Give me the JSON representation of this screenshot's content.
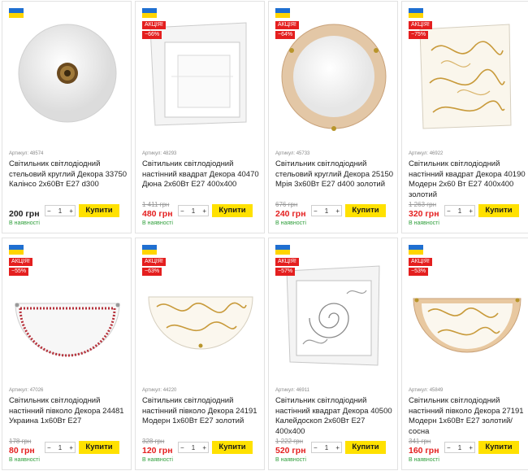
{
  "colors": {
    "sale": "#e41f1f",
    "buy_button": "#ffe100",
    "in_stock": "#2e9e3a"
  },
  "products": [
    {
      "badge": "",
      "discount": "",
      "sku": "Артикул: 48574",
      "name": "Світильник світлодіодний стельовий круглий Декора 33750 Калінсо 2х60Вт E27 d300",
      "old_price": "",
      "price": "200 грн",
      "qty": "1",
      "buy": "Купити",
      "availability": "В наявності"
    },
    {
      "badge": "АКЦІЯ!",
      "discount": "−66%",
      "sku": "Артикул: 48293",
      "name": "Світильник світлодіодний настінний квадрат Декора 40470 Дюна 2х60Вт E27 400х400",
      "old_price": "1 411 грн",
      "price": "480 грн",
      "qty": "1",
      "buy": "Купити",
      "availability": "В наявності"
    },
    {
      "badge": "АКЦІЯ!",
      "discount": "−64%",
      "sku": "Артикул: 45733",
      "name": "Світильник світлодіодний стельовий круглий Декора 25150 Мрія 3х60Вт E27 d400 золотий",
      "old_price": "676 грн",
      "price": "240 грн",
      "qty": "1",
      "buy": "Купити",
      "availability": "В наявності"
    },
    {
      "badge": "АКЦІЯ!",
      "discount": "−75%",
      "sku": "Артикул: 46922",
      "name": "Світильник світлодіодний настінний квадрат Декора 40190 Модерн 2х60 Вт E27 400х400 золотий",
      "old_price": "1 263 грн",
      "price": "320 грн",
      "qty": "1",
      "buy": "Купити",
      "availability": "В наявності"
    },
    {
      "badge": "АКЦІЯ!",
      "discount": "−55%",
      "sku": "Артикул: 47026",
      "name": "Світильник світлодіодний настінний півколо Декора 24481 Украина 1х60Вт E27",
      "old_price": "178 грн",
      "price": "80 грн",
      "qty": "1",
      "buy": "Купити",
      "availability": "В наявності"
    },
    {
      "badge": "АКЦІЯ!",
      "discount": "−63%",
      "sku": "Артикул: 44220",
      "name": "Світильник світлодіодний настінний півколо Декора 24191 Модерн 1х60Вт E27 золотий",
      "old_price": "328 грн",
      "price": "120 грн",
      "qty": "1",
      "buy": "Купити",
      "availability": "В наявності"
    },
    {
      "badge": "АКЦІЯ!",
      "discount": "−57%",
      "sku": "Артикул: 46911",
      "name": "Світильник світлодіодний настінний квадрат Декора 40500 Калейдоскоп 2х60Вт E27 400х400",
      "old_price": "1 222 грн",
      "price": "520 грн",
      "qty": "1",
      "buy": "Купити",
      "availability": "В наявності"
    },
    {
      "badge": "АКЦІЯ!",
      "discount": "−53%",
      "sku": "Артикул: 45849",
      "name": "Світильник світлодіодний настінний півколо Декора 27191 Модерн 1х60Вт E27 золотий/сосна",
      "old_price": "341 грн",
      "price": "160 грн",
      "qty": "1",
      "buy": "Купити",
      "availability": "В наявності"
    }
  ]
}
